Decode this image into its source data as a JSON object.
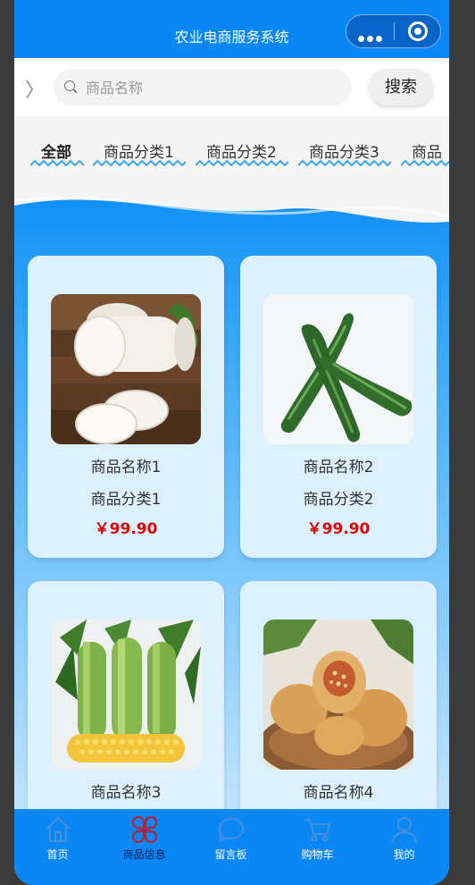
{
  "header": {
    "title": "农业电商服务系统"
  },
  "search": {
    "placeholder": "商品名称",
    "button_label": "搜索"
  },
  "tabs": [
    {
      "label": "全部"
    },
    {
      "label": "商品分类1"
    },
    {
      "label": "商品分类2"
    },
    {
      "label": "商品分类3"
    },
    {
      "label": "商品"
    }
  ],
  "products": [
    {
      "name": "商品名称1",
      "category": "商品分类1",
      "price": "￥99.90",
      "image": "white-radish"
    },
    {
      "name": "商品名称2",
      "category": "商品分类2",
      "price": "￥99.90",
      "image": "cucumber"
    },
    {
      "name": "商品名称3",
      "category": "",
      "price": "",
      "image": "corn"
    },
    {
      "name": "商品名称4",
      "category": "",
      "price": "",
      "image": "dried-figs"
    }
  ],
  "bottom_nav": [
    {
      "label": "首页",
      "icon": "home-icon"
    },
    {
      "label": "商品信息",
      "icon": "grid-clover-icon"
    },
    {
      "label": "留言板",
      "icon": "chat-bubble-icon"
    },
    {
      "label": "购物车",
      "icon": "cart-icon"
    },
    {
      "label": "我的",
      "icon": "user-icon"
    }
  ],
  "colors": {
    "primary": "#0a86f5",
    "price": "#d40b0b",
    "nav_active_icon": "#b0233a"
  }
}
